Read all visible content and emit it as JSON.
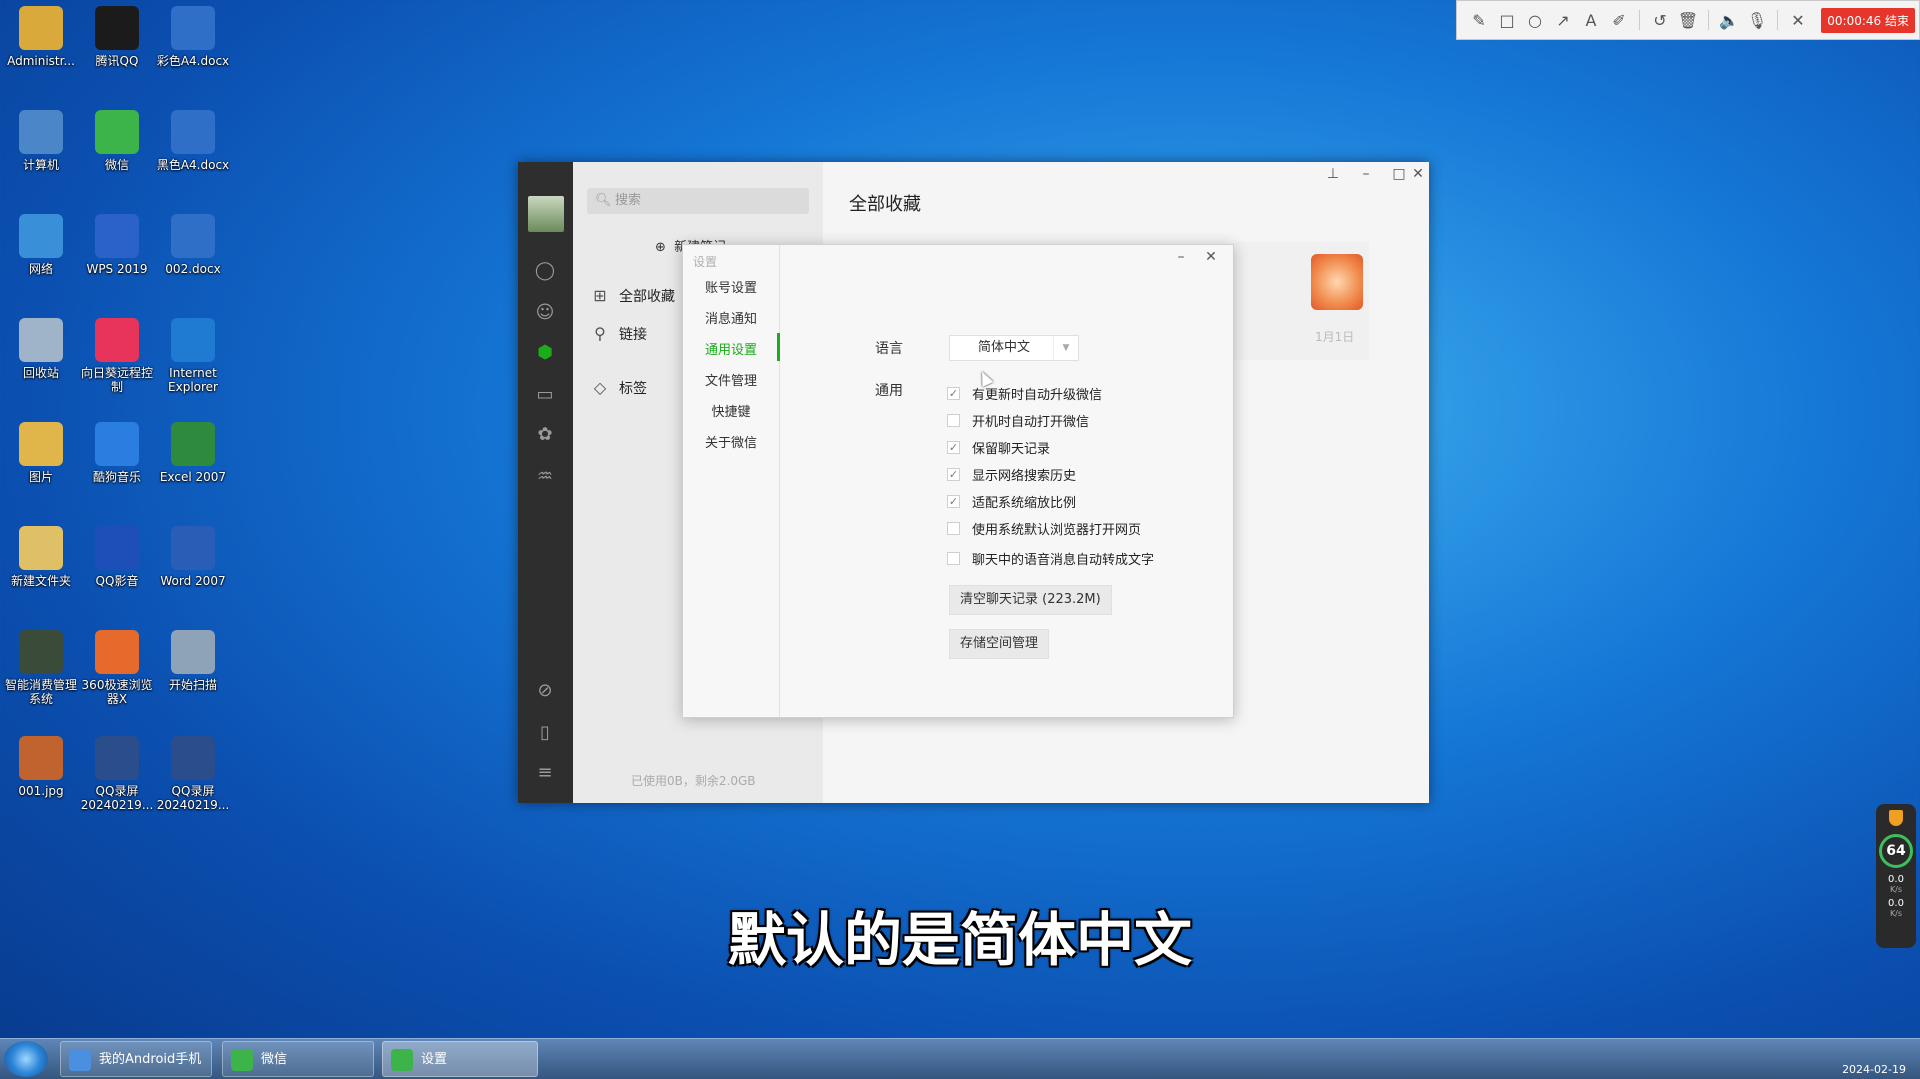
{
  "desktop": {
    "icons": [
      {
        "label": "Administr...",
        "color": "#d9a93b"
      },
      {
        "label": "腾讯QQ",
        "color": "#1b1b1b"
      },
      {
        "label": "彩色A4.docx",
        "color": "#2f6fc7"
      },
      {
        "label": "计算机",
        "color": "#4a86c8"
      },
      {
        "label": "微信",
        "color": "#3cb44a"
      },
      {
        "label": "黑色A4.docx",
        "color": "#2f6fc7"
      },
      {
        "label": "网络",
        "color": "#3a8fd9"
      },
      {
        "label": "WPS 2019",
        "color": "#2b62c9"
      },
      {
        "label": "002.docx",
        "color": "#2f6fc7"
      },
      {
        "label": "回收站",
        "color": "#9fb4c8"
      },
      {
        "label": "向日葵远程控制",
        "color": "#e8335a"
      },
      {
        "label": "Internet Explorer",
        "color": "#1f7ad1"
      },
      {
        "label": "图片",
        "color": "#e0b64a"
      },
      {
        "label": "酷狗音乐",
        "color": "#2a7ee0"
      },
      {
        "label": "Excel 2007",
        "color": "#2e8b3e"
      },
      {
        "label": "新建文件夹",
        "color": "#e0c067"
      },
      {
        "label": "QQ影音",
        "color": "#1e4fb8"
      },
      {
        "label": "Word 2007",
        "color": "#2a5db5"
      },
      {
        "label": "智能消费管理系统",
        "color": "#3b4b3a"
      },
      {
        "label": "360极速浏览器X",
        "color": "#e56a2b"
      },
      {
        "label": "开始扫描",
        "color": "#8fa3b8"
      },
      {
        "label": "001.jpg",
        "color": "#c0632f"
      },
      {
        "label": "QQ录屏20240219...",
        "color": "#2a4d8c"
      },
      {
        "label": "QQ录屏20240219...",
        "color": "#2a4d8c"
      }
    ]
  },
  "recorder": {
    "tools": [
      "pencil-icon",
      "rect-icon",
      "circle-icon",
      "arrow-icon",
      "text-icon",
      "marker-icon",
      "undo-icon",
      "trash-icon",
      "speaker-icon",
      "mic-icon",
      "close-icon"
    ],
    "glyphs": [
      "✎",
      "□",
      "○",
      "↗",
      "A",
      "✐",
      "↺",
      "🗑",
      "🔈",
      "🎙",
      "✕"
    ],
    "stop_label": "00:00:46 结束"
  },
  "wechat": {
    "search_placeholder": "搜索",
    "new_note": "新建笔记",
    "nav": {
      "all": "全部收藏",
      "links": "链接",
      "tags": "标签"
    },
    "storage": "已使用0B，剩余2.0GB",
    "main_title": "全部收藏",
    "card_date": "1月1日"
  },
  "settings": {
    "title": "设置",
    "menu": [
      "账号设置",
      "消息通知",
      "通用设置",
      "文件管理",
      "快捷键",
      "关于微信"
    ],
    "active_index": 2,
    "language_label": "语言",
    "language_value": "简体中文",
    "general_label": "通用",
    "options": [
      {
        "label": "有更新时自动升级微信",
        "checked": true
      },
      {
        "label": "开机时自动打开微信",
        "checked": false
      },
      {
        "label": "保留聊天记录",
        "checked": true
      },
      {
        "label": "显示网络搜索历史",
        "checked": true
      },
      {
        "label": "适配系统缩放比例",
        "checked": true
      },
      {
        "label": "使用系统默认浏览器打开网页",
        "checked": false
      },
      {
        "label": "聊天中的语音消息自动转成文字",
        "checked": false
      }
    ],
    "clear_button": "清空聊天记录 (223.2M)",
    "storage_button": "存储空间管理"
  },
  "subtitle": "默认的是简体中文",
  "taskbar": {
    "buttons": [
      "我的Android手机",
      "微信",
      "设置"
    ],
    "active_index": 2,
    "clock_date": "2024-02-19"
  },
  "widget": {
    "percent": "64",
    "up": "0.0",
    "down": "0.0",
    "unit": "K/s"
  },
  "colors": {
    "accent": "#1aad19",
    "sidebar": "#2e2e2e",
    "record_stop": "#e6352b"
  }
}
